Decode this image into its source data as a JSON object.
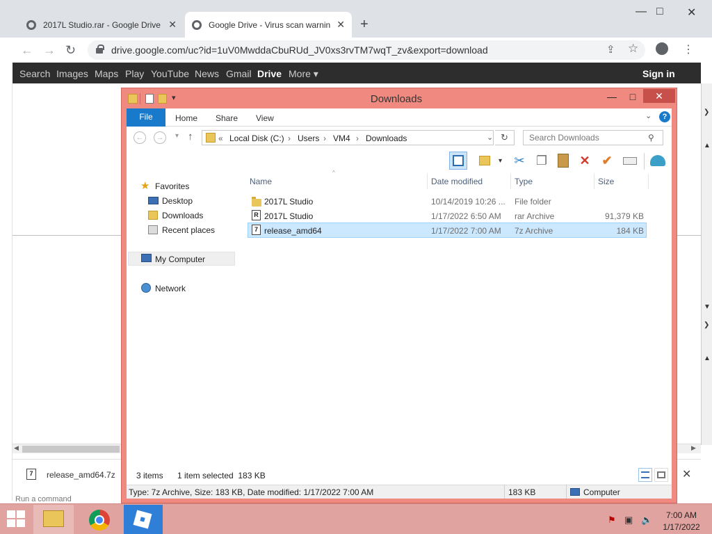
{
  "browser": {
    "tabs": [
      {
        "title": "2017L Studio.rar - Google Drive",
        "active": false
      },
      {
        "title": "Google Drive - Virus scan warnin",
        "active": true
      }
    ],
    "new_tab": "+",
    "window_controls": {
      "minimize": "—",
      "maximize": "□",
      "close": "✕"
    },
    "url": "drive.google.com/uc?id=1uV0MwddaCbuRUd_JV0xs3rvTM7wqT_zv&export=download",
    "google_bar": {
      "items": [
        "Search",
        "Images",
        "Maps",
        "Play",
        "YouTube",
        "News",
        "Gmail",
        "Drive",
        "More ▾"
      ],
      "active": "Drive",
      "sign_in": "Sign in"
    },
    "download_shelf": {
      "file": "release_amd64.7z",
      "chevron": "^",
      "close": "✕"
    },
    "status_hint": "Run a command"
  },
  "explorer": {
    "title": "Downloads",
    "ribbon_tabs": [
      "File",
      "Home",
      "Share",
      "View"
    ],
    "help": "?",
    "address": {
      "prefix": "«",
      "segments": [
        "Local Disk (C:)",
        "Users",
        "VM4",
        "Downloads"
      ],
      "separator": "›"
    },
    "search_placeholder": "Search Downloads",
    "nav": {
      "favorites": "Favorites",
      "favorite_items": [
        "Desktop",
        "Downloads",
        "Recent places"
      ],
      "my_computer": "My Computer",
      "network": "Network"
    },
    "columns": [
      "Name",
      "Date modified",
      "Type",
      "Size"
    ],
    "files": [
      {
        "name": "2017L Studio",
        "date": "10/14/2019 10:26 ...",
        "type": "File folder",
        "size": "",
        "icon": "folder-icon",
        "selected": false
      },
      {
        "name": "2017L Studio",
        "date": "1/17/2022 6:50 AM",
        "type": "rar Archive",
        "size": "91,379 KB",
        "icon": "rar-archive-icon",
        "selected": false
      },
      {
        "name": "release_amd64",
        "date": "1/17/2022 7:00 AM",
        "type": "7z Archive",
        "size": "184 KB",
        "icon": "7z-archive-icon",
        "selected": true
      }
    ],
    "status": {
      "items": "3 items",
      "selection": "1 item selected  183 KB"
    },
    "details_bar": {
      "info": "Type: 7z Archive, Size: 183 KB, Date modified: 1/17/2022 7:00 AM",
      "size": "183 KB",
      "location": "Computer"
    }
  },
  "taskbar": {
    "time": "7:00 AM",
    "date": "1/17/2022"
  },
  "colors": {
    "explorer_frame": "#f08a80",
    "close_button": "#c7504a",
    "file_tab": "#1979ca",
    "selection": "#cce8ff",
    "taskbar": "#e1a3a0"
  }
}
